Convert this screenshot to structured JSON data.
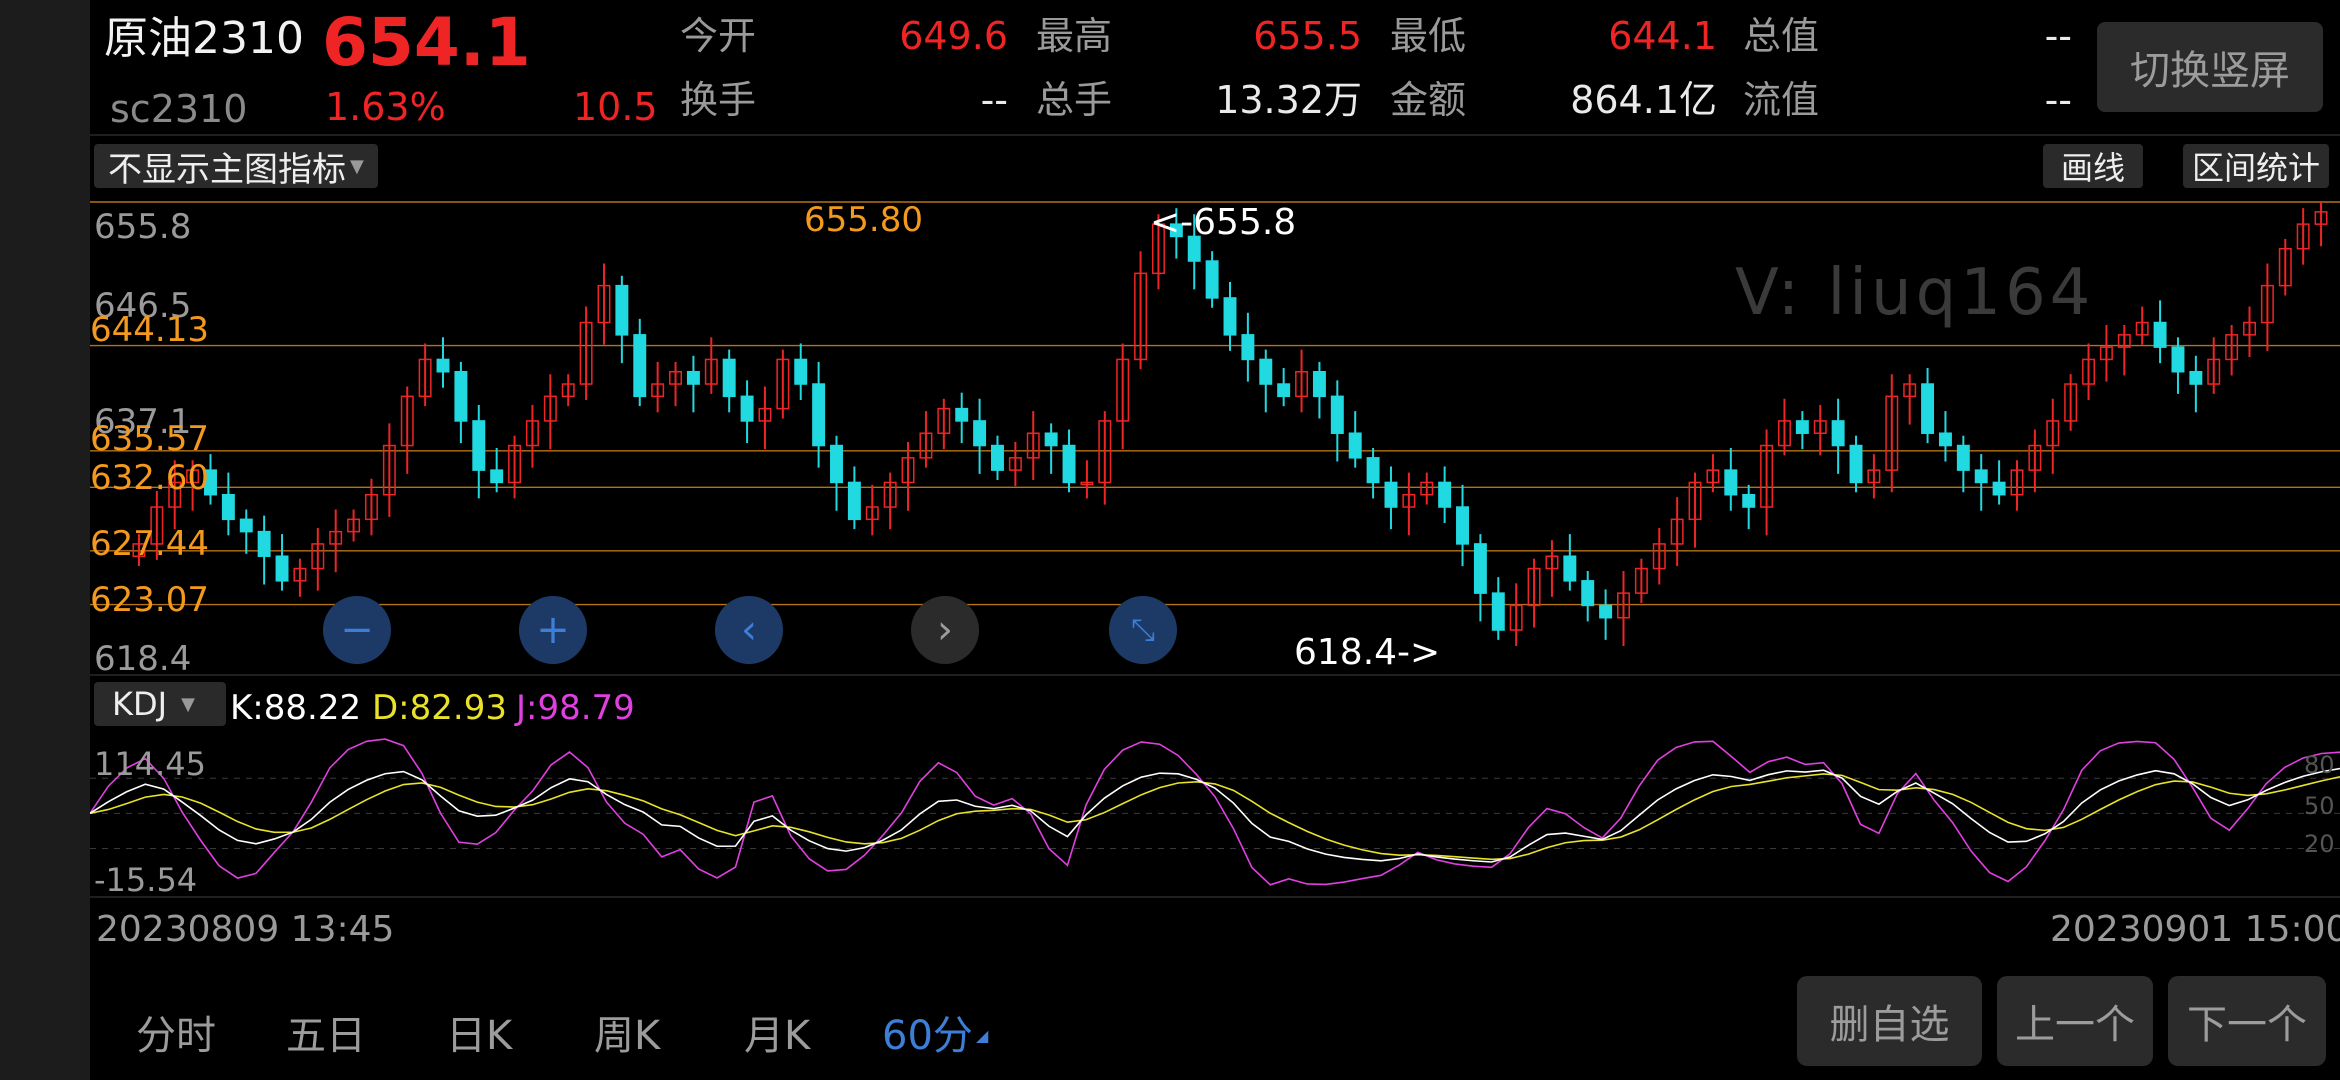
{
  "header": {
    "name": "原油2310",
    "price": "654.1",
    "code": "sc2310",
    "change_pct": "1.63%",
    "change": "10.5",
    "stats": [
      {
        "label": "今开",
        "value": "649.6",
        "color": "#ef2525"
      },
      {
        "label": "最高",
        "value": "655.5",
        "color": "#ef2525"
      },
      {
        "label": "最低",
        "value": "644.1",
        "color": "#ef2525"
      },
      {
        "label": "总值",
        "value": "--",
        "color": "#eaeaea"
      },
      {
        "label": "换手",
        "value": "--",
        "color": "#eaeaea"
      },
      {
        "label": "总手",
        "value": "13.32万",
        "color": "#eaeaea"
      },
      {
        "label": "金额",
        "value": "864.1亿",
        "color": "#eaeaea"
      },
      {
        "label": "流值",
        "value": "--",
        "color": "#eaeaea"
      }
    ],
    "switch_button": "切换竖屏"
  },
  "toolbar": {
    "indicator_select": "不显示主图指标",
    "draw_button": "画线",
    "range_button": "区间统计"
  },
  "main_chart": {
    "axis_top": "655.8",
    "axis_mid": "646.5",
    "axis_mid2": "637.1",
    "axis_bottom": "618.4",
    "levels": [
      "644.13",
      "635.57",
      "632.60",
      "627.44",
      "623.07"
    ],
    "high_label": "<-655.8",
    "low_label": "618.4->",
    "high_level_label": "655.80",
    "watermark": "V: liuq164"
  },
  "chart_controls": [
    "zoom-out",
    "zoom-in",
    "scroll-left",
    "scroll-right",
    "reset"
  ],
  "kdj": {
    "select": "KDJ",
    "k_label": "K:88.22",
    "d_label": "D:82.93",
    "j_label": "J:98.79",
    "axis_top": "114.45",
    "axis_bottom": "-15.54",
    "ref_80": "80",
    "ref_50": "50",
    "ref_20": "20",
    "colors": {
      "k": "#ffffff",
      "d": "#e8e22a",
      "j": "#e040e0"
    }
  },
  "date_range": {
    "start": "20230809 13:45",
    "end": "20230901 15:00"
  },
  "timeframes": [
    "分时",
    "五日",
    "日K",
    "周K",
    "月K",
    "60分"
  ],
  "active_timeframe": "60分",
  "bottom_buttons": {
    "delete": "删自选",
    "prev": "上一个",
    "next": "下一个"
  },
  "colors": {
    "up": "#ef2525",
    "down": "#21d9e0",
    "level": "#f39a1e",
    "active": "#3d7fd6"
  },
  "chart_data": {
    "type": "candlestick",
    "ylim": [
      618.4,
      655.8
    ],
    "close": [
      628,
      631,
      633,
      634,
      632,
      630,
      629,
      627,
      625,
      626,
      628,
      629,
      630,
      632,
      636,
      640,
      643,
      642,
      638,
      634,
      633,
      636,
      638,
      640,
      641,
      646,
      649,
      645,
      640,
      641,
      642,
      641,
      643,
      640,
      638,
      639,
      643,
      641,
      636,
      633,
      630,
      631,
      633,
      635,
      637,
      639,
      638,
      636,
      634,
      635,
      637,
      636,
      633,
      633,
      638,
      643,
      650,
      654,
      653,
      651,
      648,
      645,
      643,
      641,
      640,
      642,
      640,
      637,
      635,
      633,
      631,
      632,
      633,
      631,
      628,
      624,
      621,
      623,
      626,
      627,
      625,
      623,
      622,
      624,
      626,
      628,
      630,
      633,
      634,
      632,
      631,
      636,
      638,
      637,
      638,
      636,
      633,
      634,
      640,
      641,
      637,
      636,
      634,
      633,
      632,
      634,
      636,
      638,
      641,
      643,
      644,
      645,
      646,
      644,
      642,
      641,
      643,
      645,
      646,
      649,
      652,
      654,
      655
    ]
  }
}
